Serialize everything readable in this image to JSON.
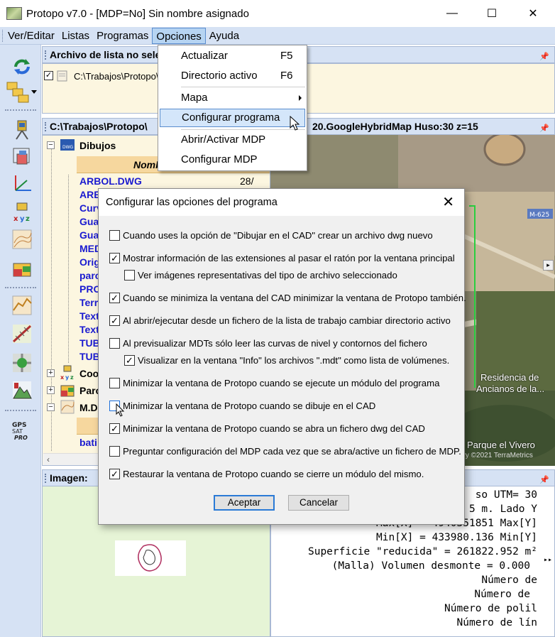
{
  "window": {
    "title": "Protopo v7.0 - [MDP=No] Sin nombre asignado",
    "minimize_glyph": "—",
    "maximize_glyph": "☐",
    "close_glyph": "✕"
  },
  "menubar": {
    "items": [
      "Ver/Editar",
      "Listas",
      "Programas",
      "Opciones",
      "Ayuda"
    ],
    "active": "Opciones"
  },
  "options_menu": {
    "items": [
      {
        "label": "Actualizar",
        "shortcut": "F5"
      },
      {
        "label": "Directorio activo",
        "shortcut": "F6"
      },
      {
        "label": "Mapa",
        "shortcut": ""
      },
      {
        "label": "Configurar programa",
        "shortcut": ""
      },
      {
        "label": "Abrir/Activar MDP",
        "shortcut": ""
      },
      {
        "label": "Configurar MDP",
        "shortcut": ""
      }
    ],
    "hovered": "Configurar programa"
  },
  "list_panel": {
    "title": "Archivo de lista no selec",
    "entry": "C:\\Trabajos\\Protopo\\",
    "checked": true
  },
  "tree_panel": {
    "title": "C:\\Trabajos\\Protopo\\",
    "root": "Dibujos",
    "column_name": "Nomb",
    "files": [
      "ARBOL.DWG",
      "ARE",
      "Curv",
      "Gua",
      "Gua",
      "MED",
      "Orig",
      "parc",
      "PRO",
      "Terr",
      "Text",
      "Text",
      "TUB",
      "TUB"
    ],
    "first_file_size": "28/",
    "groups": [
      "Coo",
      "Parc",
      "M.D"
    ],
    "last_item": "bati"
  },
  "map_panel": {
    "title": "20.GoogleHybridMap  Huso:30 z=15",
    "road_label": "M-625",
    "labels": [
      "Residencia de",
      "Ancianos de la...",
      "Parque el Vivero"
    ],
    "copyright": "ery ©2021 TerraMetrics"
  },
  "image_panel": {
    "title": "Imagen:"
  },
  "info_panel": {
    "lines": [
      "so UTM= 30",
      "5 m. Lado Y",
      "Max[X] = 4940351851 Max[Y]",
      "Min[X] = 433980.136 Min[Y]",
      "Superficie \"reducida\" = 261822.952 m²",
      "(Malla) Volumen desmonte = 0.000",
      "Número de",
      "Número de",
      "Número de polil",
      "Número de lín"
    ]
  },
  "dialog": {
    "title": "Configurar las opciones del programa",
    "options": [
      {
        "label": "Cuando uses la opción de \"Dibujar en el CAD\" crear un archivo dwg nuevo",
        "checked": false,
        "indent": false
      },
      {
        "label": "Mostrar información de las extensiones al pasar el ratón por la ventana principal",
        "checked": true,
        "indent": false
      },
      {
        "label": "Ver imágenes representativas del tipo de archivo seleccionado",
        "checked": false,
        "indent": true
      },
      {
        "label": "Cuando se minimiza la ventana del CAD minimizar la ventana de Protopo también.",
        "checked": true,
        "indent": false
      },
      {
        "label": "Al abrir/ejecutar desde un fichero de la lista de trabajo cambiar directorio activo",
        "checked": true,
        "indent": false
      },
      {
        "label": "Al previsualizar MDTs sólo leer las curvas de nivel y contornos del fichero",
        "checked": false,
        "indent": false
      },
      {
        "label": "Visualizar en la ventana \"Info\" los archivos \".mdt\" como lista de volúmenes.",
        "checked": true,
        "indent": true
      },
      {
        "label": "Minimizar la ventana de Protopo cuando se ejecute un módulo del programa",
        "checked": false,
        "indent": false
      },
      {
        "label": "Minimizar la ventana de Protopo cuando se dibuje en el CAD",
        "checked": false,
        "indent": false
      },
      {
        "label": "Minimizar la ventana de Protopo cuando se abra un fichero dwg del CAD",
        "checked": true,
        "indent": false
      },
      {
        "label": "Preguntar configuración del MDP cada vez que se abra/active un fichero de MDP.",
        "checked": false,
        "indent": false
      },
      {
        "label": "Restaurar la ventana de Protopo cuando se cierre un módulo del mismo.",
        "checked": true,
        "indent": false
      }
    ],
    "accept_label": "Aceptar",
    "cancel_label": "Cancelar"
  },
  "colors": {
    "chrome": "#d6e2f4",
    "panel_bg": "#fcf6e0",
    "tree_link": "#1a1ad0",
    "accent": "#2a7ad6"
  }
}
